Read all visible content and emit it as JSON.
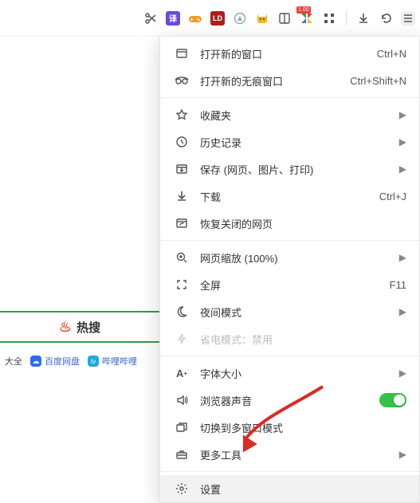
{
  "topbar": {
    "icons": {
      "scissors": "scissors-icon",
      "translate": "translate-icon",
      "gamepad": "gamepad-icon",
      "adblock": "adblock-icon",
      "compass": "compass-icon",
      "cat": "cat-icon",
      "book": "book-icon",
      "shop": "shop-icon",
      "apps": "apps-icon",
      "download": "download-icon",
      "undo": "undo-icon",
      "menu": "menu-icon"
    },
    "shop_badge": "1.00"
  },
  "menu": {
    "new_window": {
      "label": "打开新的窗口",
      "hotkey": "Ctrl+N"
    },
    "new_incognito": {
      "label": "打开新的无痕窗口",
      "hotkey": "Ctrl+Shift+N"
    },
    "favorites": {
      "label": "收藏夹"
    },
    "history": {
      "label": "历史记录"
    },
    "save": {
      "label": "保存 (网页、图片、打印)"
    },
    "downloads": {
      "label": "下载",
      "hotkey": "Ctrl+J"
    },
    "reopen_closed": {
      "label": "恢复关闭的网页"
    },
    "zoom": {
      "label": "网页缩放 (100%)"
    },
    "fullscreen": {
      "label": "全屏",
      "hotkey": "F11"
    },
    "night": {
      "label": "夜间模式"
    },
    "power": {
      "label": "省电模式：禁用"
    },
    "font": {
      "label": "字体大小"
    },
    "sound": {
      "label": "浏览器声音"
    },
    "multiwindow": {
      "label": "切换到多窗口模式"
    },
    "more_tools": {
      "label": "更多工具"
    },
    "settings": {
      "label": "设置"
    }
  },
  "page": {
    "hot": "热搜",
    "daquan": "大全",
    "baidu": "百度网盘",
    "bili": "哔哩哔哩"
  }
}
